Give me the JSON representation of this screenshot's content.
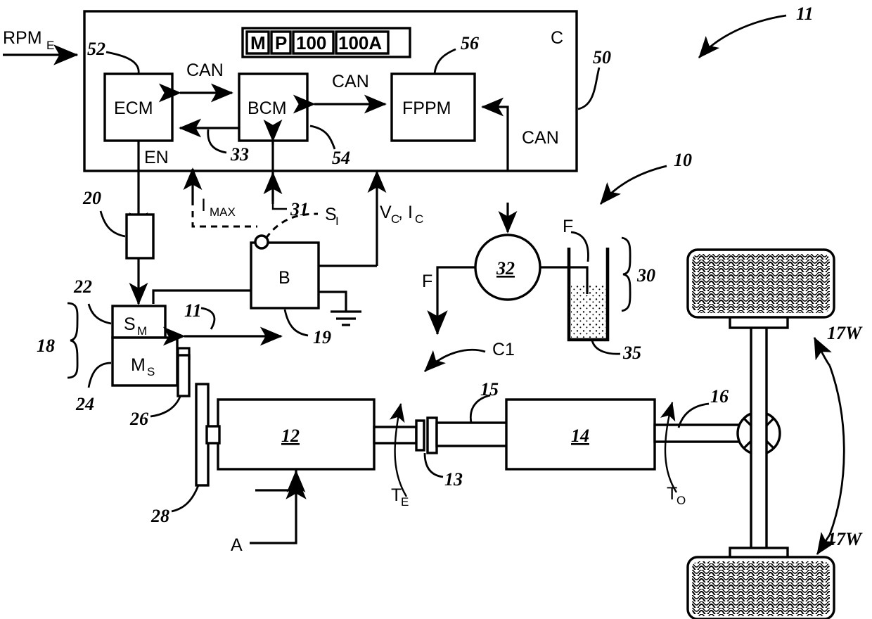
{
  "figure": {
    "type": "patent-block-diagram",
    "title": "Vehicle engine start and fuel pump control schematic",
    "background": "#ffffff",
    "line_color": "#000000"
  },
  "inputs": {
    "engine_speed_label": "RPM",
    "engine_speed_sub": "E"
  },
  "controller": {
    "box_label": "C",
    "ref": "50",
    "modules": [
      {
        "name": "ECM",
        "label": "ECM",
        "ref": "52"
      },
      {
        "name": "BCM",
        "label": "BCM",
        "ref": "54"
      },
      {
        "name": "FPPM",
        "label": "FPPM",
        "ref": "56"
      }
    ],
    "bus_labels": [
      "CAN",
      "CAN",
      "CAN"
    ],
    "signals": [
      {
        "label": "EN"
      },
      {
        "label": "33"
      },
      {
        "label": "31"
      }
    ]
  },
  "tag_box": {
    "cells": [
      "M",
      "P",
      "100",
      "100A"
    ]
  },
  "starter": {
    "relay_ref": "20",
    "solenoid_label": "S",
    "solenoid_sub": "M",
    "solenoid_ref": "22",
    "motor_label": "M",
    "motor_sub": "S",
    "motor_ref": "24",
    "pinion_ref": "26",
    "assembly_ref": "18",
    "mesh_ref": "11",
    "flywheel_ref": "28"
  },
  "battery": {
    "label": "B",
    "ref": "19",
    "switch_label": "S",
    "switch_sub": "I",
    "current_limit_label": "I",
    "current_limit_sub": "MAX",
    "sense_label": "V",
    "sense_sub1": "C",
    "sense_label2": "I",
    "sense_sub2": "C",
    "ground_symbol": "earth-ground"
  },
  "fuel_system": {
    "pump_ref": "32",
    "tank_ref": "35",
    "group_ref": "30",
    "flow_out_label": "F",
    "flow_in_label": "F",
    "bus_label": "CAN"
  },
  "driveline": {
    "engine_ref": "12",
    "engine_callout": "A",
    "crankshaft_torque_label": "T",
    "crankshaft_torque_sub": "E",
    "clutch_ref": "13",
    "clutch_callout": "C1",
    "shaft_ref": "15",
    "transmission_ref": "14",
    "output_torque_label": "T",
    "output_torque_sub": "O",
    "driveshaft_ref": "16",
    "wheel_ref_top": "17W",
    "wheel_ref_bottom": "17W"
  },
  "system_refs": {
    "vehicle": "11",
    "powertrain": "10"
  }
}
